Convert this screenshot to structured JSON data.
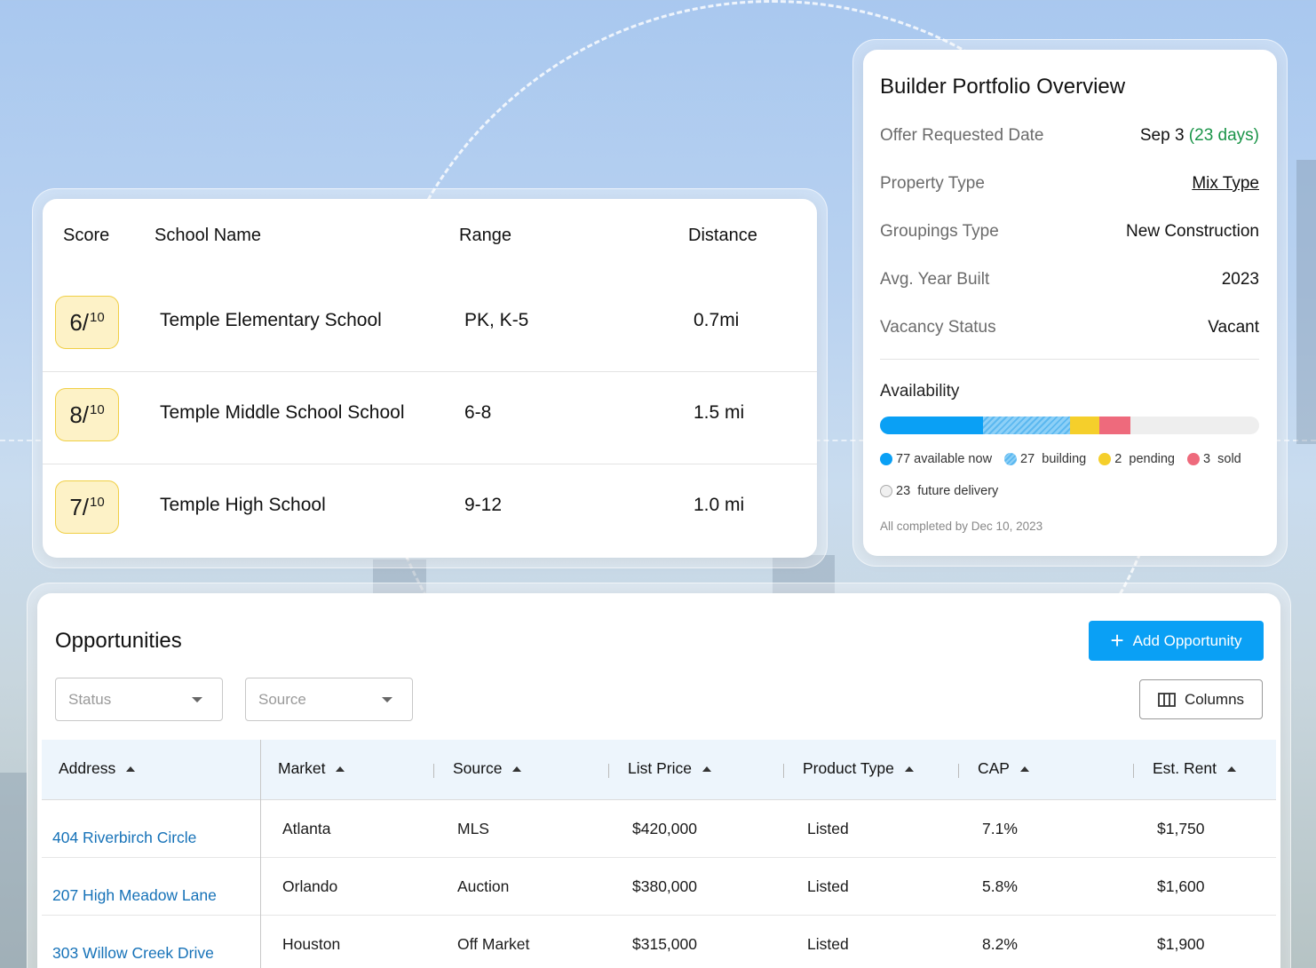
{
  "schools": {
    "headers": {
      "score": "Score",
      "name": "School Name",
      "range": "Range",
      "distance": "Distance"
    },
    "rows": [
      {
        "score": "6/",
        "score_max": "10",
        "name": "Temple Elementary School",
        "range": "PK, K-5",
        "distance": "0.7mi"
      },
      {
        "score": "8/",
        "score_max": "10",
        "name": "Temple Middle School School",
        "range": "6-8",
        "distance": "1.5 mi"
      },
      {
        "score": "7/",
        "score_max": "10",
        "name": "Temple High School",
        "range": "9-12",
        "distance": "1.0 mi"
      }
    ]
  },
  "portfolio": {
    "title": "Builder Portfolio Overview",
    "fields": {
      "offer_date": {
        "label": "Offer Requested Date",
        "value": "Sep 3",
        "extra": "(23 days)"
      },
      "property_type": {
        "label": "Property Type",
        "value": "Mix Type"
      },
      "groupings_type": {
        "label": "Groupings Type",
        "value": "New Construction"
      },
      "avg_year": {
        "label": "Avg. Year Built",
        "value": "2023"
      },
      "vacancy": {
        "label": "Vacancy Status",
        "value": "Vacant"
      }
    },
    "availability": {
      "title": "Availability",
      "available": {
        "count": "77",
        "label": "available now",
        "fraction": 0.272
      },
      "building": {
        "count": "27",
        "label": "building",
        "fraction": 0.229
      },
      "pending": {
        "count": "2",
        "label": "pending",
        "fraction": 0.077
      },
      "sold": {
        "count": "3",
        "label": "sold",
        "fraction": 0.082
      },
      "future": {
        "count": "23",
        "label": "future delivery"
      },
      "colors": {
        "available": "#0aa0f5",
        "building": "#5bb8f0",
        "pending": "#f5cf2b",
        "sold": "#ee6a7c"
      }
    },
    "completed_note": "All completed by Dec 10, 2023"
  },
  "opportunities": {
    "title": "Opportunities",
    "add_button": "Add Opportunity",
    "status_placeholder": "Status",
    "source_placeholder": "Source",
    "columns_button": "Columns",
    "columns": [
      "Address",
      "Market",
      "Source",
      "List Price",
      "Product Type",
      "CAP",
      "Est. Rent"
    ],
    "rows": [
      {
        "address": "404 Riverbirch Circle",
        "market": "Atlanta",
        "source": "MLS",
        "price": "$420,000",
        "type": "Listed",
        "cap": "7.1%",
        "rent": "$1,750"
      },
      {
        "address": "207 High Meadow Lane",
        "market": "Orlando",
        "source": "Auction",
        "price": "$380,000",
        "type": "Listed",
        "cap": "5.8%",
        "rent": "$1,600"
      },
      {
        "address": "303 Willow Creek Drive",
        "market": "Houston",
        "source": "Off Market",
        "price": "$315,000",
        "type": "Listed",
        "cap": "8.2%",
        "rent": "$1,900"
      }
    ]
  }
}
